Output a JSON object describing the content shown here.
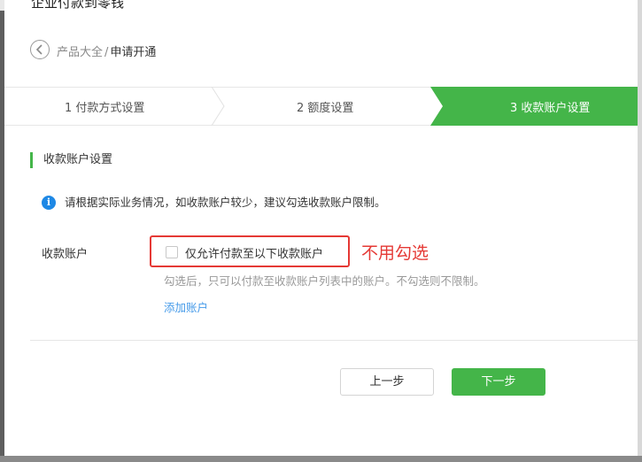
{
  "dialog": {
    "top_title": "企业付款到零钱"
  },
  "breadcrumb": {
    "root": "产品大全",
    "separator": "/",
    "current": "申请开通"
  },
  "steps": [
    {
      "label": "1 付款方式设置",
      "active": false
    },
    {
      "label": "2 额度设置",
      "active": false
    },
    {
      "label": "3 收款账户设置",
      "active": true
    }
  ],
  "section": {
    "title": "收款账户设置"
  },
  "notice": {
    "icon": "info-icon",
    "text": "请根据实际业务情况，如收款账户较少，建议勾选收款账户限制。"
  },
  "form": {
    "field_label": "收款账户",
    "checkbox_label": "仅允许付款至以下收款账户",
    "checkbox_checked": false,
    "annotation": "不用勾选",
    "hint": "勾选后，只可以付款至收款账户列表中的账户。不勾选则不限制。",
    "add_link": "添加账户"
  },
  "buttons": {
    "prev": "上一步",
    "next": "下一步"
  },
  "colors": {
    "accent": "#44b549",
    "link": "#459ae9",
    "annotation_red": "#e53935",
    "info_blue": "#1e88e5"
  }
}
